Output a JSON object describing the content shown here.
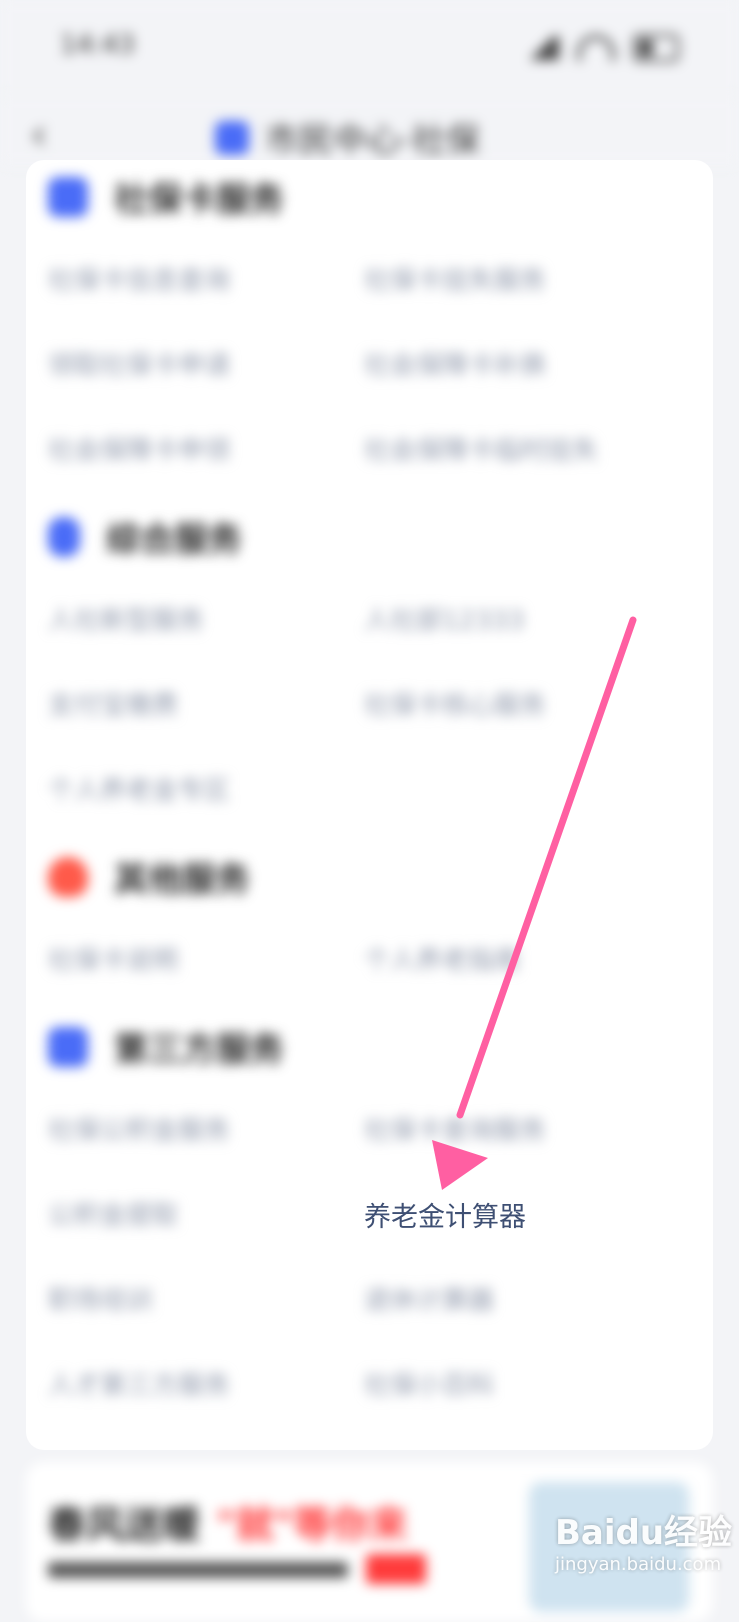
{
  "status_bar": {
    "time": "14:43"
  },
  "header": {
    "back_icon": "chevron-left-icon",
    "title": "市民中心·社保"
  },
  "sections": [
    {
      "title": "社保卡服务",
      "icon": "card-icon",
      "color": "#4a6cf7",
      "items": [
        "社保卡信息查询",
        "社保卡挂失服务",
        "领取社保卡申请",
        "社会保障卡补换",
        "社会保障卡申领",
        "社会保障卡临时挂失"
      ]
    },
    {
      "title": "综合服务",
      "icon": "phone-icon",
      "color": "#4a6cf7",
      "items": [
        "人社新型服务",
        "人社部12333",
        "支付宝缴费",
        "社保卡核心服务",
        "个人养老金专区"
      ]
    },
    {
      "title": "其他服务",
      "icon": "flame-icon",
      "color": "#ff5a4a",
      "items": [
        "社保卡说明",
        "个人养老指南"
      ]
    },
    {
      "title": "第三方服务",
      "icon": "grid-icon",
      "color": "#4a6cf7",
      "items": [
        "社保公积金服务",
        "社保卡查询服务",
        "公积金提取",
        "养老金计算器",
        "职场培训",
        "退休计算器",
        "人才第三方服务",
        "社保小百科"
      ]
    }
  ],
  "banner": {
    "title": "春风送暖",
    "accent": "\"就\"等你来"
  },
  "watermark": {
    "main": "Baidu经验",
    "sub": "jingyan.baidu.com"
  },
  "annotation": {
    "color": "#ff5fa2",
    "target": "养老金计算器"
  }
}
